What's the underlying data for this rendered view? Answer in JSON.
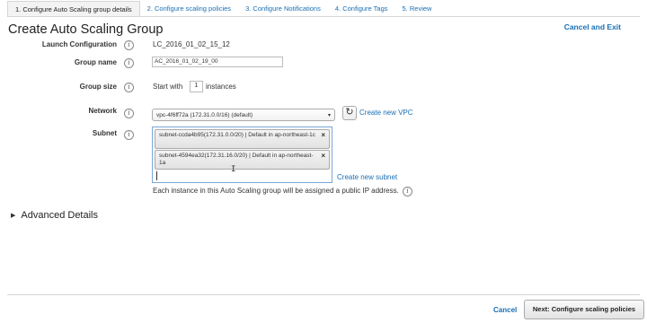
{
  "tabs": [
    {
      "label": "1. Configure Auto Scaling group details",
      "active": true
    },
    {
      "label": "2. Configure scaling policies"
    },
    {
      "label": "3. Configure Notifications"
    },
    {
      "label": "4. Configure Tags"
    },
    {
      "label": "5. Review"
    }
  ],
  "page_title": "Create Auto Scaling Group",
  "cancel_exit": "Cancel and Exit",
  "form": {
    "launch_config": {
      "label": "Launch Configuration",
      "value": "LC_2016_01_02_15_12"
    },
    "group_name": {
      "label": "Group name",
      "value": "AC_2016_01_02_19_00"
    },
    "group_size": {
      "label": "Group size",
      "prefix": "Start with",
      "value": "1",
      "suffix": "instances"
    },
    "network": {
      "label": "Network",
      "value": "vpc-4f6ff72a (172.31.0.0/16) (default)",
      "create_link": "Create new VPC"
    },
    "subnet": {
      "label": "Subnet",
      "chips": [
        {
          "text": "subnet-ccda4b95(172.31.0.0/20) | Default in ap-northeast-1c"
        },
        {
          "text": "subnet-4594ea32(172.31.16.0/20) | Default in ap-northeast-1a"
        }
      ],
      "create_link": "Create new subnet",
      "note": "Each instance in this Auto Scaling group will be assigned a public IP address."
    }
  },
  "advanced_details": "Advanced Details",
  "footer": {
    "cancel": "Cancel",
    "next": "Next: Configure scaling policies"
  },
  "icons": {
    "info": "info-icon",
    "refresh": "refresh-icon",
    "remove": "close-icon",
    "expand": "triangle-right-icon"
  },
  "colors": {
    "link": "#1a6fb5",
    "tab_active_bg": "#f3f3f3"
  }
}
